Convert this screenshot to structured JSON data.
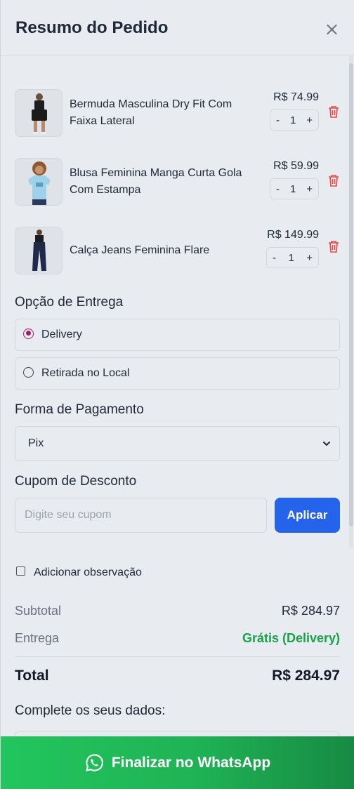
{
  "header": {
    "title": "Resumo do Pedido"
  },
  "items": [
    {
      "name": "Bermuda Masculina Dry Fit Com Faixa Lateral",
      "price": "R$ 74.99",
      "qty": "1"
    },
    {
      "name": "Blusa Feminina Manga Curta Gola Com Estampa",
      "price": "R$ 59.99",
      "qty": "1"
    },
    {
      "name": "Calça Jeans Feminina Flare",
      "price": "R$ 149.99",
      "qty": "1"
    }
  ],
  "qty_minus": "-",
  "qty_plus": "+",
  "delivery": {
    "title": "Opção de Entrega",
    "options": [
      {
        "label": "Delivery",
        "selected": true
      },
      {
        "label": "Retirada no Local",
        "selected": false
      }
    ]
  },
  "payment": {
    "title": "Forma de Pagamento",
    "selected": "Pix"
  },
  "coupon": {
    "title": "Cupom de Desconto",
    "placeholder": "Digite seu cupom",
    "button": "Aplicar"
  },
  "observation": {
    "label": "Adicionar observação"
  },
  "summary": {
    "subtotal_label": "Subtotal",
    "subtotal_value": "R$ 284.97",
    "delivery_label": "Entrega",
    "delivery_value": "Grátis (Delivery)",
    "total_label": "Total",
    "total_value": "R$ 284.97"
  },
  "complete_label": "Complete os seus dados:",
  "whatsapp_button": "Finalizar no WhatsApp",
  "colors": {
    "accent": "#2563eb",
    "whatsapp": "#22c55e",
    "delete": "#ef4444",
    "radio": "#a01b6b",
    "free": "#16a34a"
  }
}
